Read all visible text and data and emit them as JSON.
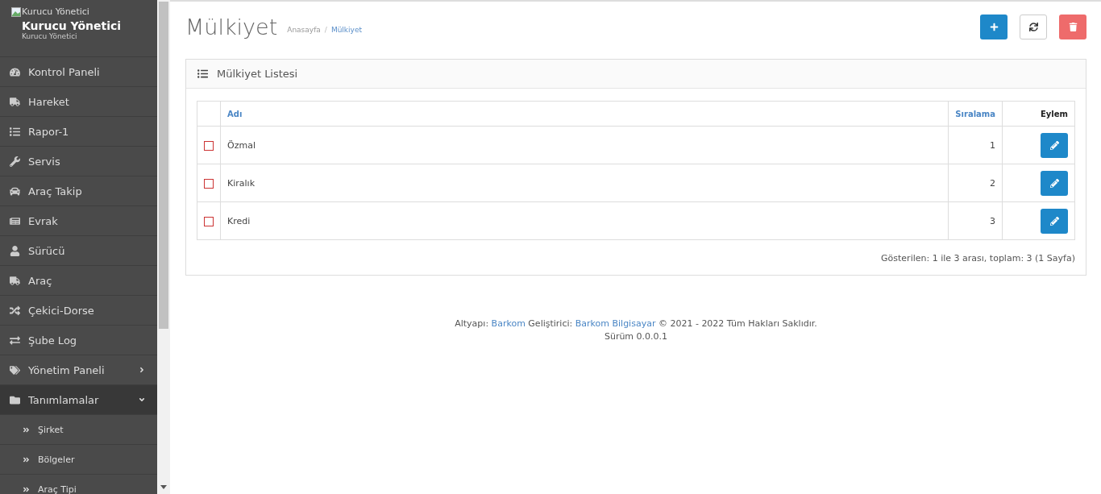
{
  "user": {
    "image_alt": "Kurucu Yönetici",
    "name": "Kurucu Yönetici",
    "role": "Kurucu Yönetici"
  },
  "menu": [
    {
      "label": "Kontrol Paneli",
      "selected": false
    },
    {
      "label": "Hareket",
      "selected": false
    },
    {
      "label": "Rapor-1",
      "selected": false
    },
    {
      "label": "Servis",
      "selected": false
    },
    {
      "label": "Araç Takip",
      "selected": false
    },
    {
      "label": "Evrak",
      "selected": false
    },
    {
      "label": "Sürücü",
      "selected": false
    },
    {
      "label": "Araç",
      "selected": false
    },
    {
      "label": "Çekici-Dorse",
      "selected": false
    },
    {
      "label": "Şube Log",
      "selected": false
    },
    {
      "label": "Yönetim Paneli",
      "selected": false,
      "expanded": false
    },
    {
      "label": "Tanımlamalar",
      "selected": true,
      "expanded": true,
      "children": [
        {
          "label": "Şirket"
        },
        {
          "label": "Bölgeler"
        },
        {
          "label": "Araç Tipi"
        }
      ]
    }
  ],
  "page": {
    "title": "Mülkiyet",
    "breadcrumb": [
      {
        "label": "Anasayfa",
        "current": false
      },
      {
        "label": "Mülkiyet",
        "current": true
      }
    ],
    "separator": "/"
  },
  "panel": {
    "title": "Mülkiyet Listesi"
  },
  "table": {
    "columns": [
      {
        "label": "Adı"
      },
      {
        "label": "Sıralama"
      },
      {
        "label": "Eylem"
      }
    ],
    "rows": [
      {
        "checked": false,
        "name": "Özmal",
        "order": "1"
      },
      {
        "checked": false,
        "name": "Kiralık",
        "order": "2"
      },
      {
        "checked": false,
        "name": "Kredi",
        "order": "3"
      }
    ]
  },
  "summary": "Gösterilen: 1 ile 3 arası, toplam: 3 (1 Sayfa)",
  "footer": {
    "parts": [
      {
        "kind": "text",
        "text": "Altyapı:"
      },
      {
        "kind": "link",
        "text": "Barkom"
      },
      {
        "kind": "text",
        "text": "Geliştirici:"
      },
      {
        "kind": "link",
        "text": "Barkom Bilgisayar"
      },
      {
        "kind": "text",
        "text": "© 2021 - 2022 Tüm Hakları Saklıdır."
      }
    ],
    "version": "Sürüm 0.0.0.1"
  }
}
